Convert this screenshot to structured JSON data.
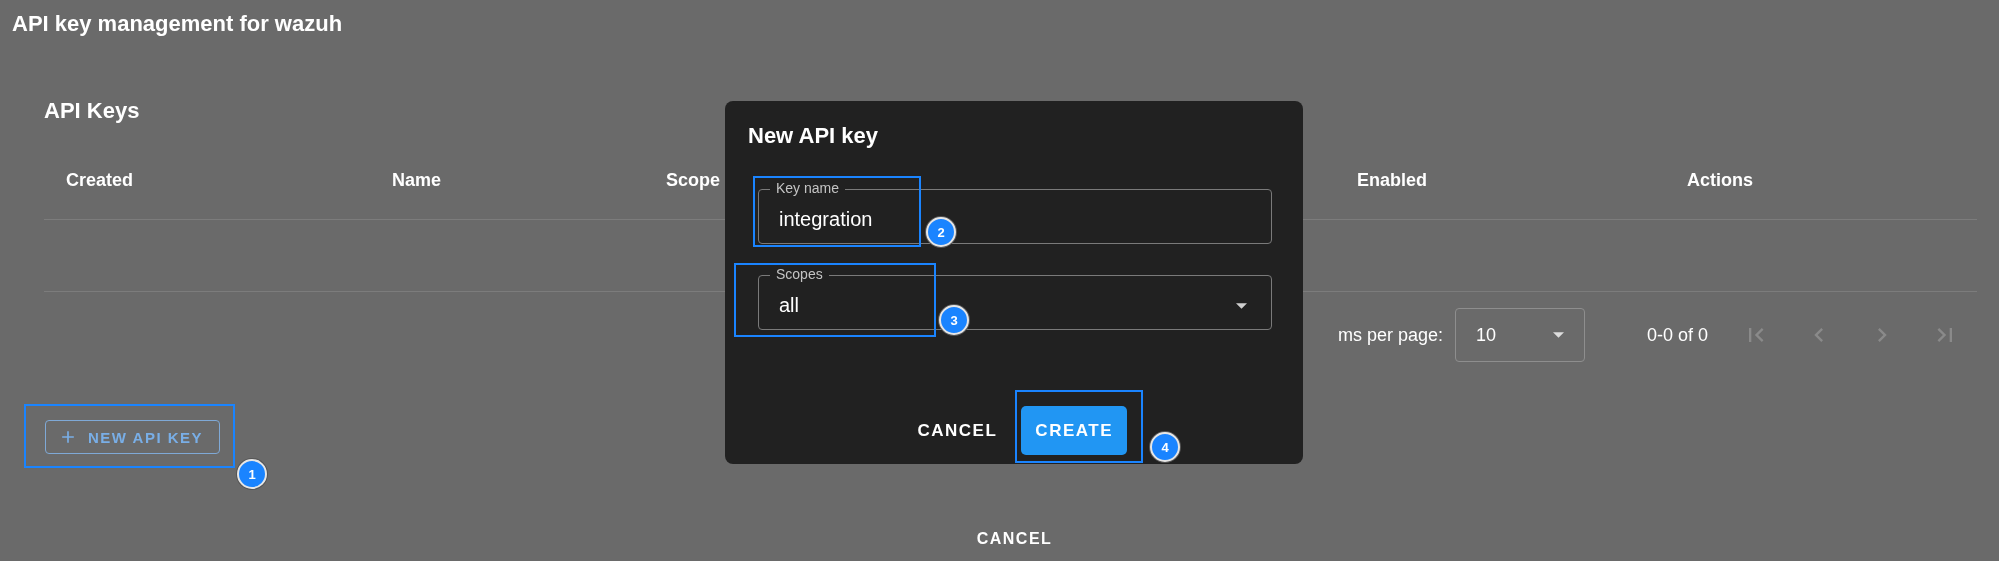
{
  "page": {
    "title": "API key management for wazuh"
  },
  "section": {
    "title": "API Keys"
  },
  "table": {
    "columns": [
      "Created",
      "Name",
      "Scope",
      "Enabled",
      "Actions"
    ]
  },
  "pagination": {
    "rows_label": "ms per page:",
    "rows_per_page": "10",
    "range": "0-0 of 0",
    "buttons": [
      {
        "kind": "first",
        "disabled": true
      },
      {
        "kind": "previous",
        "disabled": true
      },
      {
        "kind": "next",
        "disabled": true
      },
      {
        "kind": "last",
        "disabled": true
      }
    ]
  },
  "new_key_button": {
    "label": "NEW API KEY"
  },
  "footer": {
    "cancel": "CANCEL"
  },
  "dialog": {
    "title": "New API key",
    "fields": [
      {
        "kind": "text",
        "label": "Key name",
        "value": "integration"
      },
      {
        "kind": "select",
        "label": "Scopes",
        "value": "all"
      }
    ],
    "buttons": [
      {
        "kind": "text",
        "label": "CANCEL"
      },
      {
        "kind": "contained",
        "label": "CREATE"
      }
    ]
  },
  "annotations": [
    {
      "number": "1"
    },
    {
      "number": "2"
    },
    {
      "number": "3"
    },
    {
      "number": "4"
    }
  ]
}
